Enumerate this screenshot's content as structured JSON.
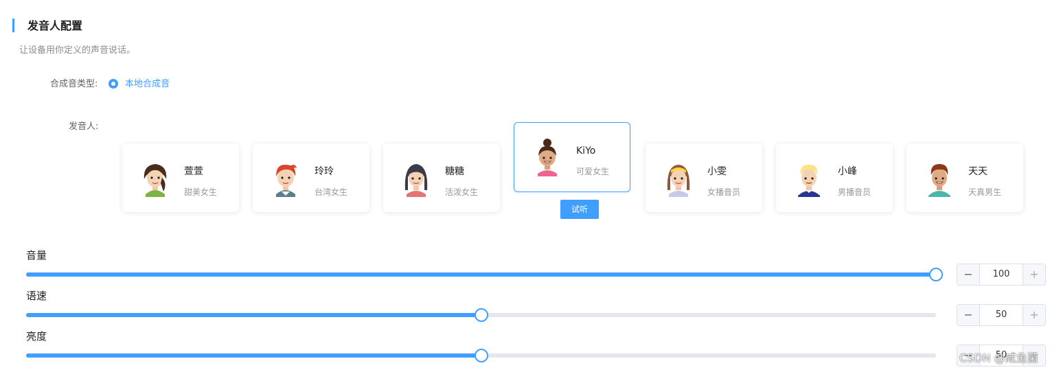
{
  "header": {
    "title": "发音人配置",
    "subtitle": "让设备用你定义的声音说话。"
  },
  "synth_type": {
    "label": "合成音类型:",
    "option": "本地合成音",
    "selected": true
  },
  "speaker": {
    "label": "发音人:",
    "cards": [
      {
        "name": "萱萱",
        "desc": "甜美女生",
        "avatar": "girl-braid-avatar",
        "selected": false
      },
      {
        "name": "玲玲",
        "desc": "台湾女生",
        "avatar": "girl-redhair-avatar",
        "selected": false
      },
      {
        "name": "糖糖",
        "desc": "活泼女生",
        "avatar": "girl-darkhair-avatar",
        "selected": false
      },
      {
        "name": "KiYo",
        "desc": "可爱女生",
        "avatar": "girl-bun-avatar",
        "selected": true
      },
      {
        "name": "小雯",
        "desc": "女播音员",
        "avatar": "girl-headband-avatar",
        "selected": false
      },
      {
        "name": "小峰",
        "desc": "男播音员",
        "avatar": "boy-blond-avatar",
        "selected": false
      },
      {
        "name": "天天",
        "desc": "天真男生",
        "avatar": "boy-brown-avatar",
        "selected": false
      }
    ],
    "listen_button": "试听"
  },
  "sliders": [
    {
      "label": "音量",
      "value": 100,
      "display": "100",
      "min": 0,
      "max": 100
    },
    {
      "label": "语速",
      "value": 50,
      "display": "50",
      "min": 0,
      "max": 100
    },
    {
      "label": "亮度",
      "value": 50,
      "display": "50",
      "min": 0,
      "max": 100
    }
  ],
  "stepper": {
    "minus": "−",
    "plus": "+"
  },
  "watermark": "CSDN @咸鱼菌",
  "colors": {
    "accent": "#409eff",
    "track": "#e4e7ed",
    "border": "#dcdfe6"
  }
}
